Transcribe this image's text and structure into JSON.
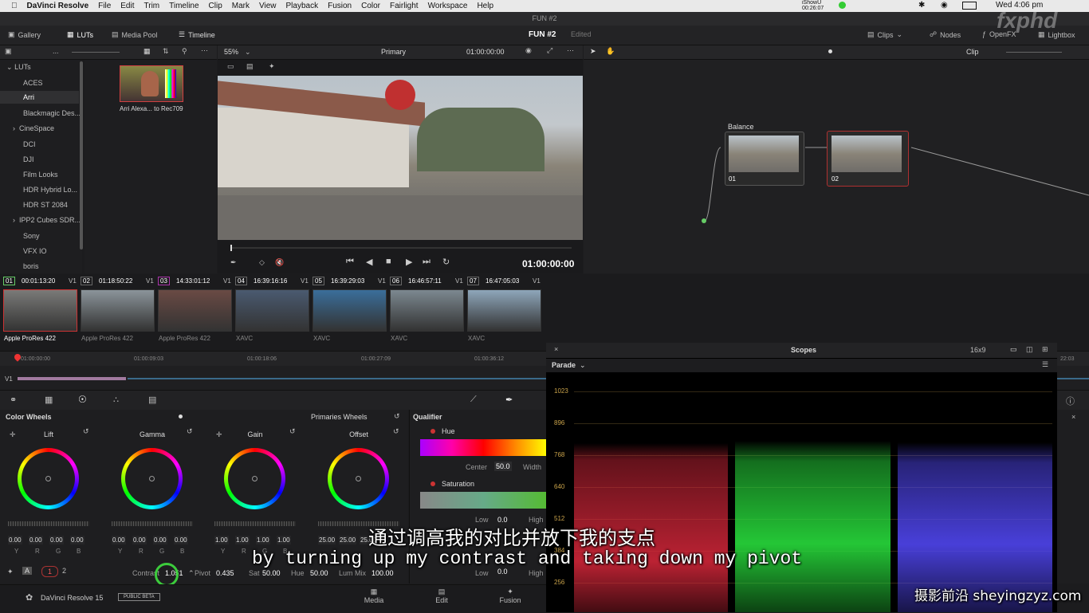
{
  "mac_menu": {
    "app": "DaVinci Resolve",
    "items": [
      "File",
      "Edit",
      "Trim",
      "Timeline",
      "Clip",
      "Mark",
      "View",
      "Playback",
      "Fusion",
      "Color",
      "Fairlight",
      "Workspace",
      "Help"
    ],
    "status_user": "iShowU",
    "status_time": "00:26:07",
    "clock": "Wed 4:06 pm"
  },
  "window_title": "FUN #2",
  "toolbar": {
    "gallery": "Gallery",
    "luts": "LUTs",
    "media_pool": "Media Pool",
    "timeline": "Timeline",
    "project": "FUN #2",
    "edited": "Edited",
    "clips": "Clips",
    "nodes": "Nodes",
    "openfx": "OpenFX",
    "lightbox": "Lightbox"
  },
  "viewer_bar": {
    "zoom": "55%",
    "primary": "Primary",
    "timecode": "01:00:00:00",
    "clip": "Clip"
  },
  "lut_tree": [
    "LUTs",
    "ACES",
    "Arri",
    "Blackmagic Des...",
    "CineSpace",
    "DCI",
    "DJI",
    "Film Looks",
    "HDR Hybrid Lo...",
    "HDR ST 2084",
    "IPP2 Cubes SDR...",
    "Sony",
    "VFX IO",
    "boris"
  ],
  "lut_thumb_label": "Arri Alexa... to Rec709",
  "viewer_timecode": "01:00:00:00",
  "nodes": {
    "balance_label": "Balance",
    "node1": "01",
    "node2": "02"
  },
  "clips": [
    {
      "num": "01",
      "tc": "00:01:13:20",
      "track": "V1",
      "codec": "Apple ProRes 422"
    },
    {
      "num": "02",
      "tc": "01:18:50:22",
      "track": "V1",
      "codec": "Apple ProRes 422"
    },
    {
      "num": "03",
      "tc": "14:33:01:12",
      "track": "V1",
      "codec": "Apple ProRes 422"
    },
    {
      "num": "04",
      "tc": "16:39:16:16",
      "track": "V1",
      "codec": "XAVC"
    },
    {
      "num": "05",
      "tc": "16:39:29:03",
      "track": "V1",
      "codec": "XAVC"
    },
    {
      "num": "06",
      "tc": "16:46:57:11",
      "track": "V1",
      "codec": "XAVC"
    },
    {
      "num": "07",
      "tc": "16:47:05:03",
      "track": "V1",
      "codec": "XAVC"
    }
  ],
  "timeline_ticks": [
    "01:00:00:00",
    "01:00:09:03",
    "01:00:18:06",
    "01:00:27:09",
    "01:00:36:12"
  ],
  "timeline_end_tc": "22:03",
  "track_label": "V1",
  "color_wheels": {
    "title": "Color Wheels",
    "mode": "Primaries Wheels",
    "wheels": [
      {
        "name": "Lift",
        "values": [
          "0.00",
          "0.00",
          "0.00",
          "0.00"
        ]
      },
      {
        "name": "Gamma",
        "values": [
          "0.00",
          "0.00",
          "0.00",
          "0.00"
        ]
      },
      {
        "name": "Gain",
        "values": [
          "1.00",
          "1.00",
          "1.00",
          "1.00"
        ]
      },
      {
        "name": "Offset",
        "values": [
          "25.00",
          "25.00",
          "25.00"
        ]
      }
    ],
    "channel_labels": [
      "Y",
      "R",
      "G",
      "B"
    ]
  },
  "adjust": {
    "contrast_label": "Contrast",
    "contrast": "1.051",
    "pivot_label": "Pivot",
    "pivot": "0.435",
    "sat_label": "Sat",
    "sat": "50.00",
    "hue_label": "Hue",
    "hue": "50.00",
    "lummix_label": "Lum Mix",
    "lummix": "100.00",
    "page1": "1",
    "page2": "2"
  },
  "qualifier": {
    "title": "Qualifier",
    "hue": "Hue",
    "center_label": "Center",
    "center": "50.0",
    "width_label": "Width",
    "saturation": "Saturation",
    "low_label": "Low",
    "low": "0.0",
    "high_label": "High"
  },
  "scopes": {
    "title": "Scopes",
    "layout": "16x9",
    "mode": "Parade",
    "scale": [
      "1023",
      "896",
      "768",
      "640",
      "512",
      "384",
      "256"
    ]
  },
  "bottom": {
    "app": "DaVinci Resolve 15",
    "beta": "PUBLIC BETA",
    "media": "Media",
    "edit": "Edit",
    "fusion": "Fusion"
  },
  "subtitles": {
    "zh": "通过调高我的对比并放下我的支点",
    "en": "by turning up my contrast and taking down my pivot"
  },
  "watermark": {
    "fxphd": "fxphd",
    "site": "摄影前沿 sheyingzyz.com"
  }
}
